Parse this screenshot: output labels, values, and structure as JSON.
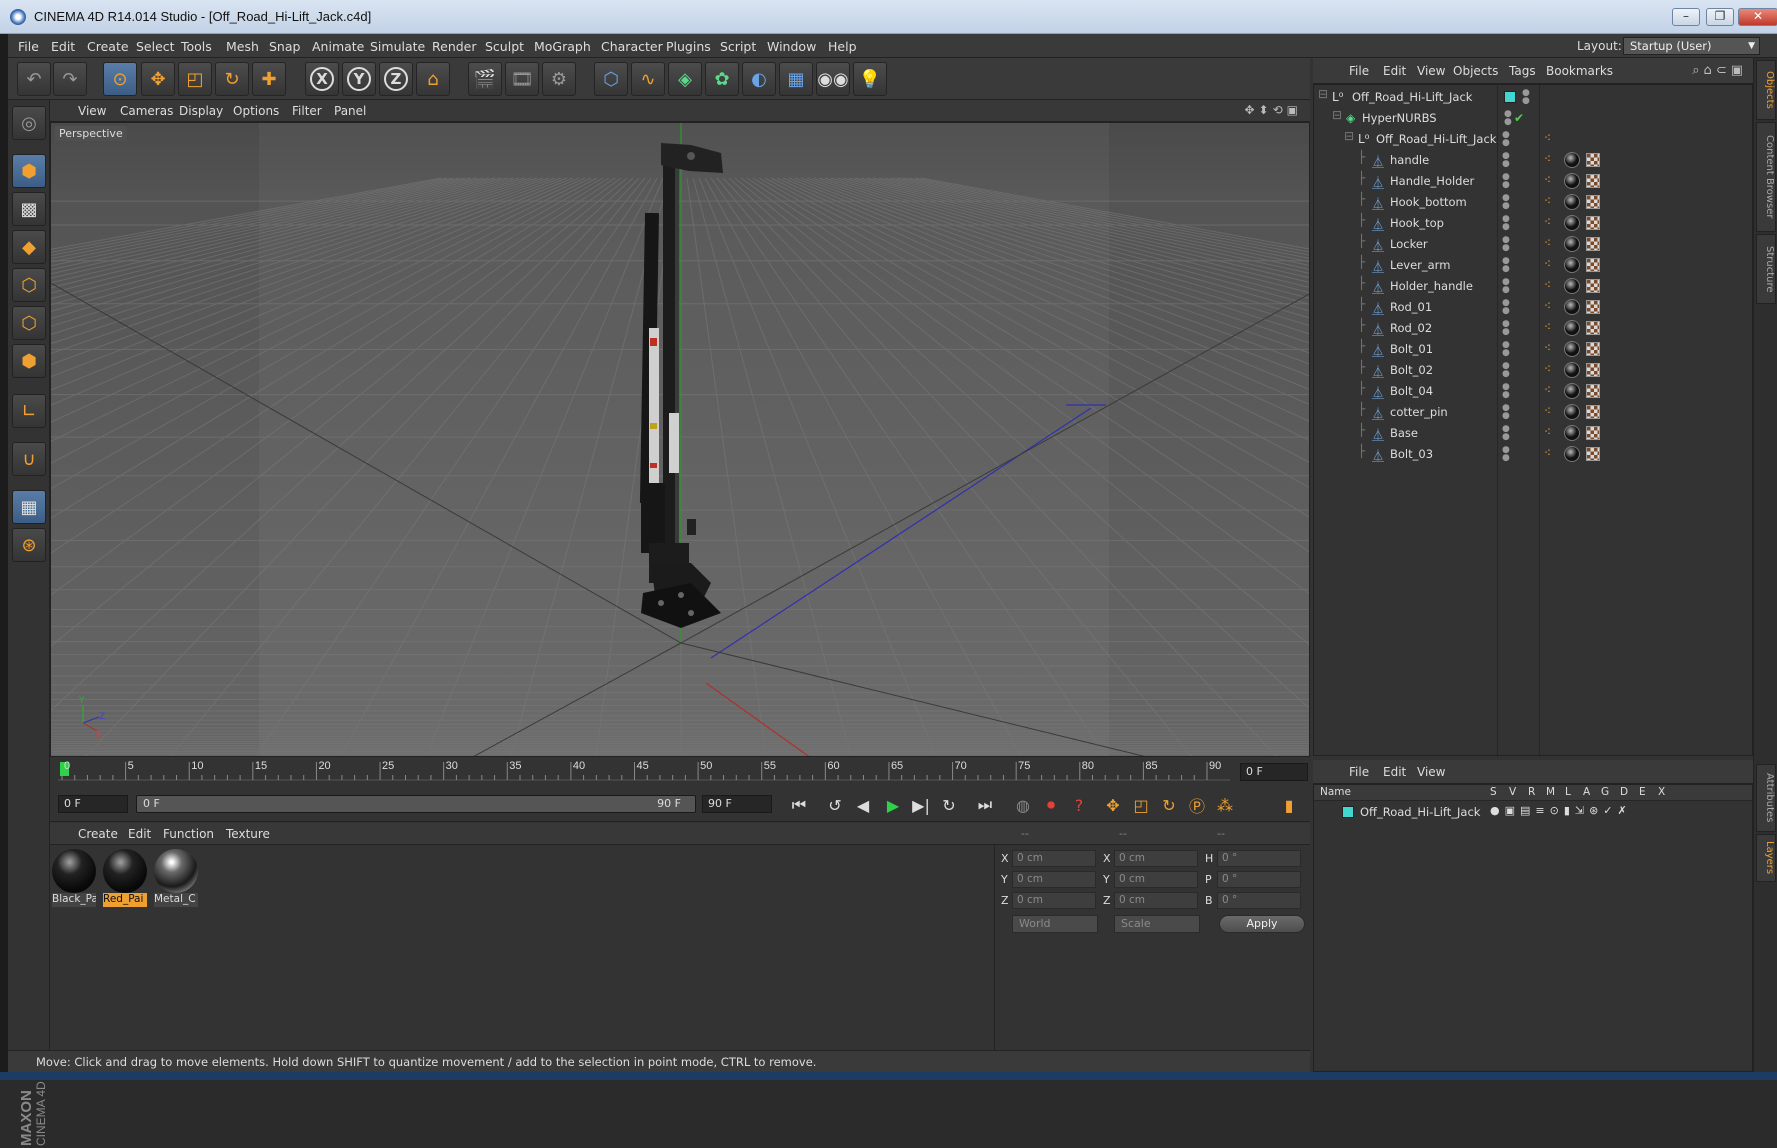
{
  "window": {
    "title": "CINEMA 4D R14.014 Studio - [Off_Road_Hi-Lift_Jack.c4d]"
  },
  "menu": [
    "File",
    "Edit",
    "Create",
    "Select",
    "Tools",
    "Mesh",
    "Snap",
    "Animate",
    "Simulate",
    "Render",
    "Sculpt",
    "MoGraph",
    "Character",
    "Plugins",
    "Script",
    "Window",
    "Help"
  ],
  "layout": {
    "label": "Layout:",
    "value": "Startup (User)"
  },
  "toolbar": {
    "icons": [
      "undo-icon",
      "redo-icon",
      "live-selection-icon",
      "move-icon",
      "scale-icon",
      "rotate-icon",
      "add-icon",
      "x-axis-lock-icon",
      "y-axis-lock-icon",
      "z-axis-lock-icon",
      "coordinate-system-icon",
      "render-view-icon",
      "render-picture-viewer-icon",
      "edit-render-settings-icon",
      "cube-primitive-icon",
      "spline-pen-icon",
      "nurbs-icon",
      "array-icon",
      "deformer-icon",
      "floor-scene-icon",
      "camera-icon",
      "light-icon"
    ],
    "axis_labels": [
      "X",
      "Y",
      "Z"
    ]
  },
  "viewport": {
    "menu": [
      "View",
      "Cameras",
      "Display",
      "Options",
      "Filter",
      "Panel"
    ],
    "label": "Perspective",
    "axes_labels": {
      "y": "Y",
      "z": "Z",
      "x": "X"
    }
  },
  "timeline": {
    "ticks": [
      "0",
      "5",
      "10",
      "15",
      "20",
      "25",
      "30",
      "35",
      "40",
      "45",
      "50",
      "55",
      "60",
      "65",
      "70",
      "75",
      "80",
      "85",
      "90"
    ],
    "current_frame": "0 F"
  },
  "transport": {
    "start": "0 F",
    "range_start": "0 F",
    "range_end": "90 F",
    "end": "90 F"
  },
  "materials": {
    "menu": [
      "Create",
      "Edit",
      "Function",
      "Texture"
    ],
    "items": [
      {
        "label": "Black_Pa",
        "kind": "black",
        "selected": false
      },
      {
        "label": "Red_Pai",
        "kind": "black",
        "selected": true
      },
      {
        "label": "Metal_C",
        "kind": "metal",
        "selected": false
      }
    ]
  },
  "coordinates": {
    "headers": [
      "--",
      "--",
      "--"
    ],
    "rows": [
      {
        "a": "X",
        "av": "0 cm",
        "b": "X",
        "bv": "0 cm",
        "c": "H",
        "cv": "0 °"
      },
      {
        "a": "Y",
        "av": "0 cm",
        "b": "Y",
        "bv": "0 cm",
        "c": "P",
        "cv": "0 °"
      },
      {
        "a": "Z",
        "av": "0 cm",
        "b": "Z",
        "bv": "0 cm",
        "c": "B",
        "cv": "0 °"
      }
    ],
    "space": "World",
    "mode": "Scale",
    "apply": "Apply"
  },
  "status": "Move: Click and drag to move elements. Hold down SHIFT to quantize movement / add to the selection in point mode, CTRL to remove.",
  "brand": {
    "maxon": "MAXON",
    "cinema": "CINEMA 4D"
  },
  "objects": {
    "menu": [
      "File",
      "Edit",
      "View",
      "Objects",
      "Tags",
      "Bookmarks"
    ],
    "root": "Off_Road_Hi-Lift_Jack",
    "hypernurbs": "HyperNURBS",
    "group": "Off_Road_Hi-Lift_Jack",
    "children": [
      "handle",
      "Handle_Holder",
      "Hook_bottom",
      "Hook_top",
      "Locker",
      "Lever_arm",
      "Holder_handle",
      "Rod_01",
      "Rod_02",
      "Bolt_01",
      "Bolt_02",
      "Bolt_04",
      "cotter_pin",
      "Base",
      "Bolt_03"
    ]
  },
  "layers": {
    "menu": [
      "File",
      "Edit",
      "View"
    ],
    "columns": [
      "Name",
      "S",
      "V",
      "R",
      "M",
      "L",
      "A",
      "G",
      "D",
      "E",
      "X"
    ],
    "row_name": "Off_Road_Hi-Lift_Jack"
  },
  "side_tabs": [
    "Objects",
    "Content Browser",
    "Structure",
    "Attributes",
    "Layers"
  ],
  "colors": {
    "accent": "#f0a030",
    "layer": "#41d6d0",
    "play": "#2fd04a"
  }
}
